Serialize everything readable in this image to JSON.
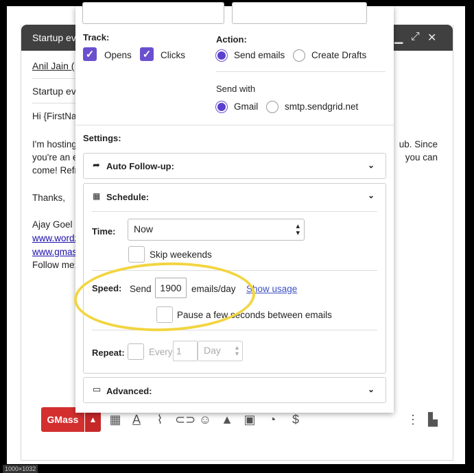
{
  "compose": {
    "title": "Startup ev",
    "to": "Anil Jain (",
    "subject": "Startup ev",
    "body_lines": [
      "Hi {FirstNa",
      "I'm hosting",
      "you're an e",
      "come! Refr",
      "Thanks,",
      "Ajay Goel",
      "www.wordz",
      "www.gmas",
      "Follow me:"
    ],
    "right_lines": [
      "ub. Since",
      "you can"
    ]
  },
  "toolbar": {
    "gmass_label": "GMass",
    "icons": [
      "grid-icon",
      "text-format-icon",
      "attach-icon",
      "link-icon",
      "emoji-icon",
      "drive-icon",
      "photo-icon",
      "schedule-icon",
      "dollar-icon"
    ]
  },
  "panel": {
    "track_label": "Track:",
    "opens_label": "Opens",
    "clicks_label": "Clicks",
    "action_label": "Action:",
    "send_emails_label": "Send emails",
    "create_drafts_label": "Create Drafts",
    "send_with_label": "Send with",
    "gmail_label": "Gmail",
    "smtp_label": "smtp.sendgrid.net",
    "settings_label": "Settings:",
    "auto_followup_label": "Auto Follow-up:",
    "schedule_label": "Schedule:",
    "time_label": "Time:",
    "time_value": "Now",
    "skip_weekends_label": "Skip weekends",
    "speed_label": "Speed:",
    "send_label": "Send",
    "speed_value": "1900",
    "emails_per_day_label": "emails/day",
    "show_usage_label": "Show usage",
    "pause_label": "Pause a few seconds between emails",
    "repeat_label": "Repeat:",
    "every_label": "Every",
    "every_value": "1",
    "day_value": "Day",
    "advanced_label": "Advanced:"
  },
  "footnote": "1000×1032",
  "colors": {
    "accent": "#6a4fcf",
    "gmass": "#d32f2f",
    "highlight": "#f2d541"
  }
}
